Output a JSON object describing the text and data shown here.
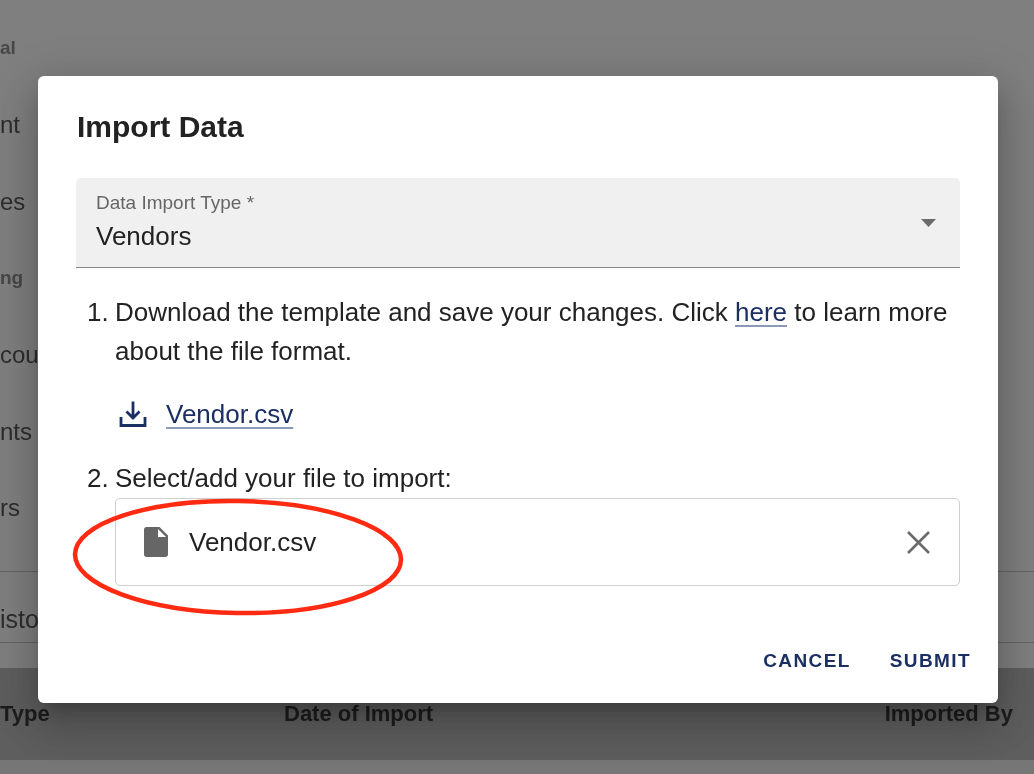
{
  "background": {
    "sidebar": {
      "items": [
        {
          "label": "al",
          "kind": "header"
        },
        {
          "label": "nt",
          "kind": "item"
        },
        {
          "label": "es",
          "kind": "item"
        },
        {
          "label": "ng",
          "kind": "header"
        },
        {
          "label": "cou",
          "kind": "item"
        },
        {
          "label": "nts",
          "kind": "item"
        },
        {
          "label": "rs",
          "kind": "item"
        }
      ]
    },
    "section_title": "isto",
    "table": {
      "columns": [
        "Type",
        "Date of Import",
        "Imported By"
      ]
    }
  },
  "dialog": {
    "title": "Import Data",
    "select": {
      "label": "Data Import Type *",
      "value": "Vendors"
    },
    "steps": [
      {
        "number": "1.",
        "text": "Download the template and save your changes. Click ",
        "link": "here",
        "text_after": " to learn more about the file format.",
        "download": {
          "label": "Vendor.csv"
        }
      },
      {
        "number": "2.",
        "text": "Select/add your file to import:",
        "file": {
          "name": "Vendor.csv"
        }
      }
    ],
    "buttons": [
      "CANCEL",
      "SUBMIT"
    ]
  },
  "annotation": {
    "kind": "ellipse"
  }
}
